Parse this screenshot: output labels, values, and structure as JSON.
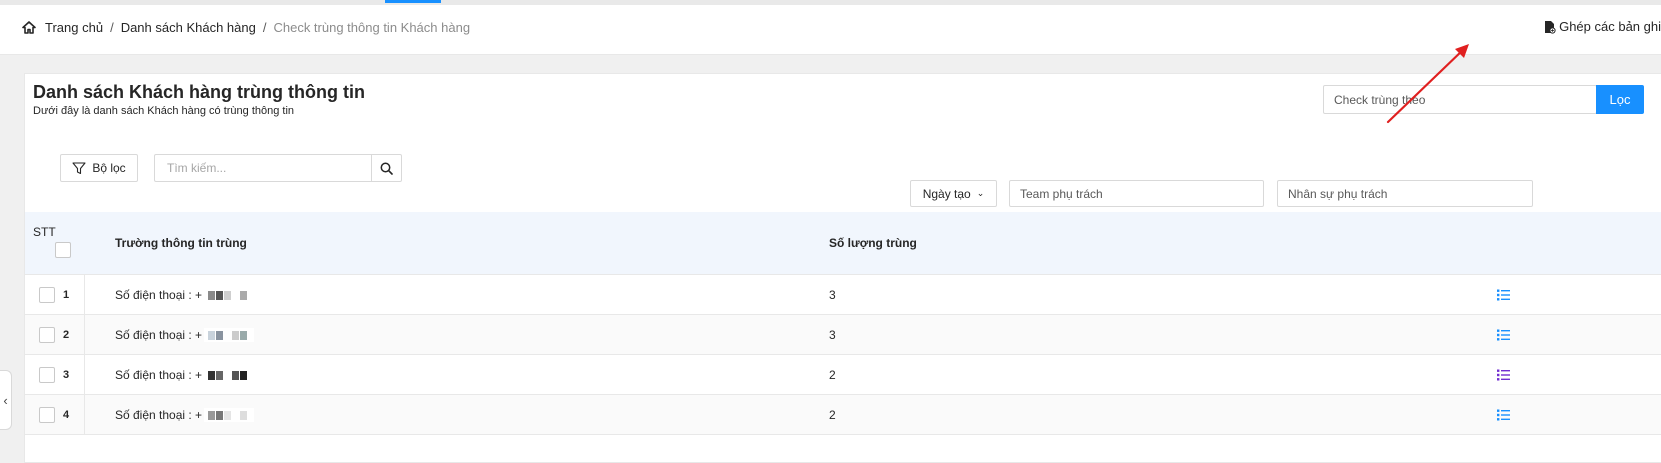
{
  "breadcrumb": {
    "home": "Trang chủ",
    "separator": "/",
    "list": "Danh sách Khách hàng",
    "current": "Check trùng thông tin Khách hàng"
  },
  "header": {
    "merge_label": "Ghép các bản ghi"
  },
  "card": {
    "title": "Danh sách Khách hàng trùng thông tin",
    "subtitle": "Dưới đây là danh sách Khách hàng có trùng thông tin"
  },
  "dup_check": {
    "placeholder": "Check trùng theo",
    "button": "Lọc"
  },
  "toolbar": {
    "filter_label": "Bộ lọc",
    "search_placeholder": "Tìm kiếm...",
    "date_label": "Ngày tạo",
    "team_placeholder": "Team phụ trách",
    "staff_placeholder": "Nhân sự phụ trách"
  },
  "table": {
    "col_stt": "STT",
    "col_field": "Trường thông tin trùng",
    "col_count": "Số lượng trùng",
    "rows": [
      {
        "no": "1",
        "field": "Số điện thoại : +",
        "count": "3"
      },
      {
        "no": "2",
        "field": "Số điện thoại : +",
        "count": "3"
      },
      {
        "no": "3",
        "field": "Số điện thoại : +",
        "count": "2"
      },
      {
        "no": "4",
        "field": "Số điện thoại : +",
        "count": "2"
      }
    ]
  },
  "icons": {
    "home": "home-icon",
    "merge": "file-merge-icon",
    "filter": "funnel-icon",
    "search": "magnifier-icon",
    "detail": "list-icon",
    "collapse": "chevron-left-icon"
  },
  "colors": {
    "accent": "#1890ff",
    "detail_visited": "#722ed1",
    "arrow": "#e02020"
  }
}
